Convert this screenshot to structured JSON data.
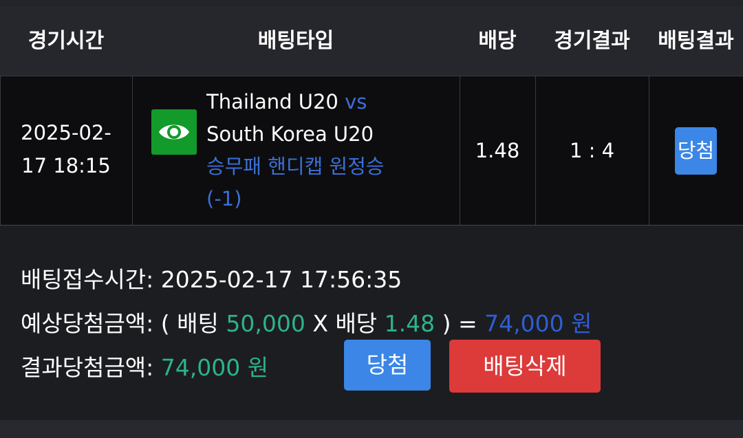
{
  "table": {
    "headers": {
      "time": "경기시간",
      "bet_type": "배팅타입",
      "odds": "배당",
      "match_result": "경기결과",
      "bet_result": "배팅결과"
    },
    "row": {
      "date_line": "2025-02-",
      "time_line": "17 18:15",
      "icon": "eye-icon",
      "home_team": "Thailand U20",
      "vs": "vs",
      "away_team": "South Korea U20",
      "market": "승무패 핸디캡 원정승",
      "handicap": "(-1)",
      "odds": "1.48",
      "score": "1 : 4",
      "result_badge": "당첨"
    }
  },
  "details": {
    "received_label": "배팅접수시간:",
    "received_value": "2025-02-17 17:56:35",
    "expected_label": "예상당첨금액:",
    "open_paren": "( 배팅",
    "stake": "50,000",
    "times": "X 배당",
    "odds": "1.48",
    "close_paren": ") =",
    "expected_amount": "74,000 원",
    "result_label": "결과당첨금액:",
    "result_amount": "74,000 원"
  },
  "buttons": {
    "win": "당첨",
    "delete": "배팅삭제"
  },
  "colors": {
    "win_blue": "#3b86e6",
    "delete_red": "#dd3a3a",
    "green_text": "#2db38a",
    "blue_text": "#2f5ed4",
    "eye_green": "#129a2a"
  }
}
